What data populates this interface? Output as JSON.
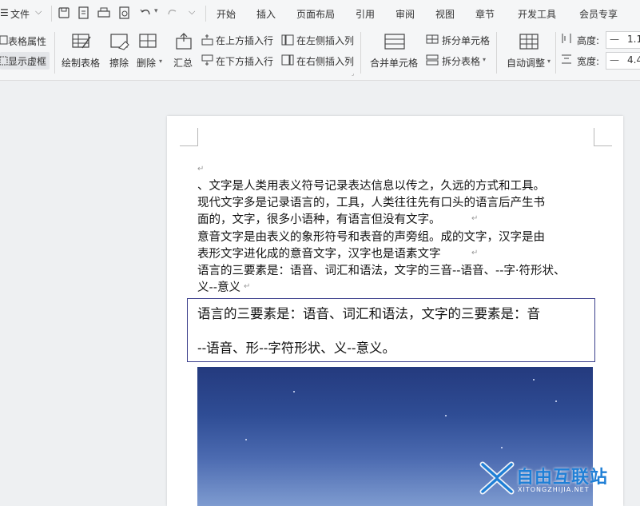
{
  "menu": {
    "file_label": "文件",
    "tabs": [
      "开始",
      "插入",
      "页面布局",
      "引用",
      "审阅",
      "视图",
      "章节",
      "开发工具",
      "会员专享"
    ]
  },
  "ribbon": {
    "table_properties": "表格属性",
    "show_gridlines": "显示虚框",
    "draw_table": "绘制表格",
    "erase": "擦除",
    "delete": "删除",
    "summary": "汇总",
    "insert_above": "在上方插入行",
    "insert_below": "在下方插入行",
    "insert_left": "在左侧插入列",
    "insert_right": "在右侧插入列",
    "merge_cells": "合并单元格",
    "split_cells": "拆分单元格",
    "split_table": "拆分表格",
    "auto_fit": "自动调整",
    "height_label": "高度:",
    "height_value": "1.1",
    "width_label": "宽度:",
    "width_value": "4.4",
    "minus": "—"
  },
  "document": {
    "paragraphs": [
      "、文字是人类用表义符号记录表达信息以传之，久远的方式和工具。",
      "现代文字多是记录语言的，工具，人类往往先有口头的语言后产生书",
      "面的，文字，很多小语种，有语言但没有文字。",
      "意音文字是由表义的象形符号和表音的声旁组。成的文字，汉字是由",
      "表形文字进化成的意音文字，汉字也是语素文字",
      "语言的三要素是：语音、词汇和语法，文字的三音--语音、--字·符形状、",
      "义--意义"
    ],
    "para_mark": "↵",
    "textbox_lines": [
      "语言的三要素是：语音、词汇和语法，文字的三要素是：音",
      "--语音、形--字符形状、义--意义。"
    ]
  },
  "watermark": {
    "text": "自由互联站",
    "sub": "XITONGZHIJIA.NET"
  },
  "colors": {
    "textbox_border": "#3b3f8c",
    "watermark": "#1f7fd6"
  }
}
